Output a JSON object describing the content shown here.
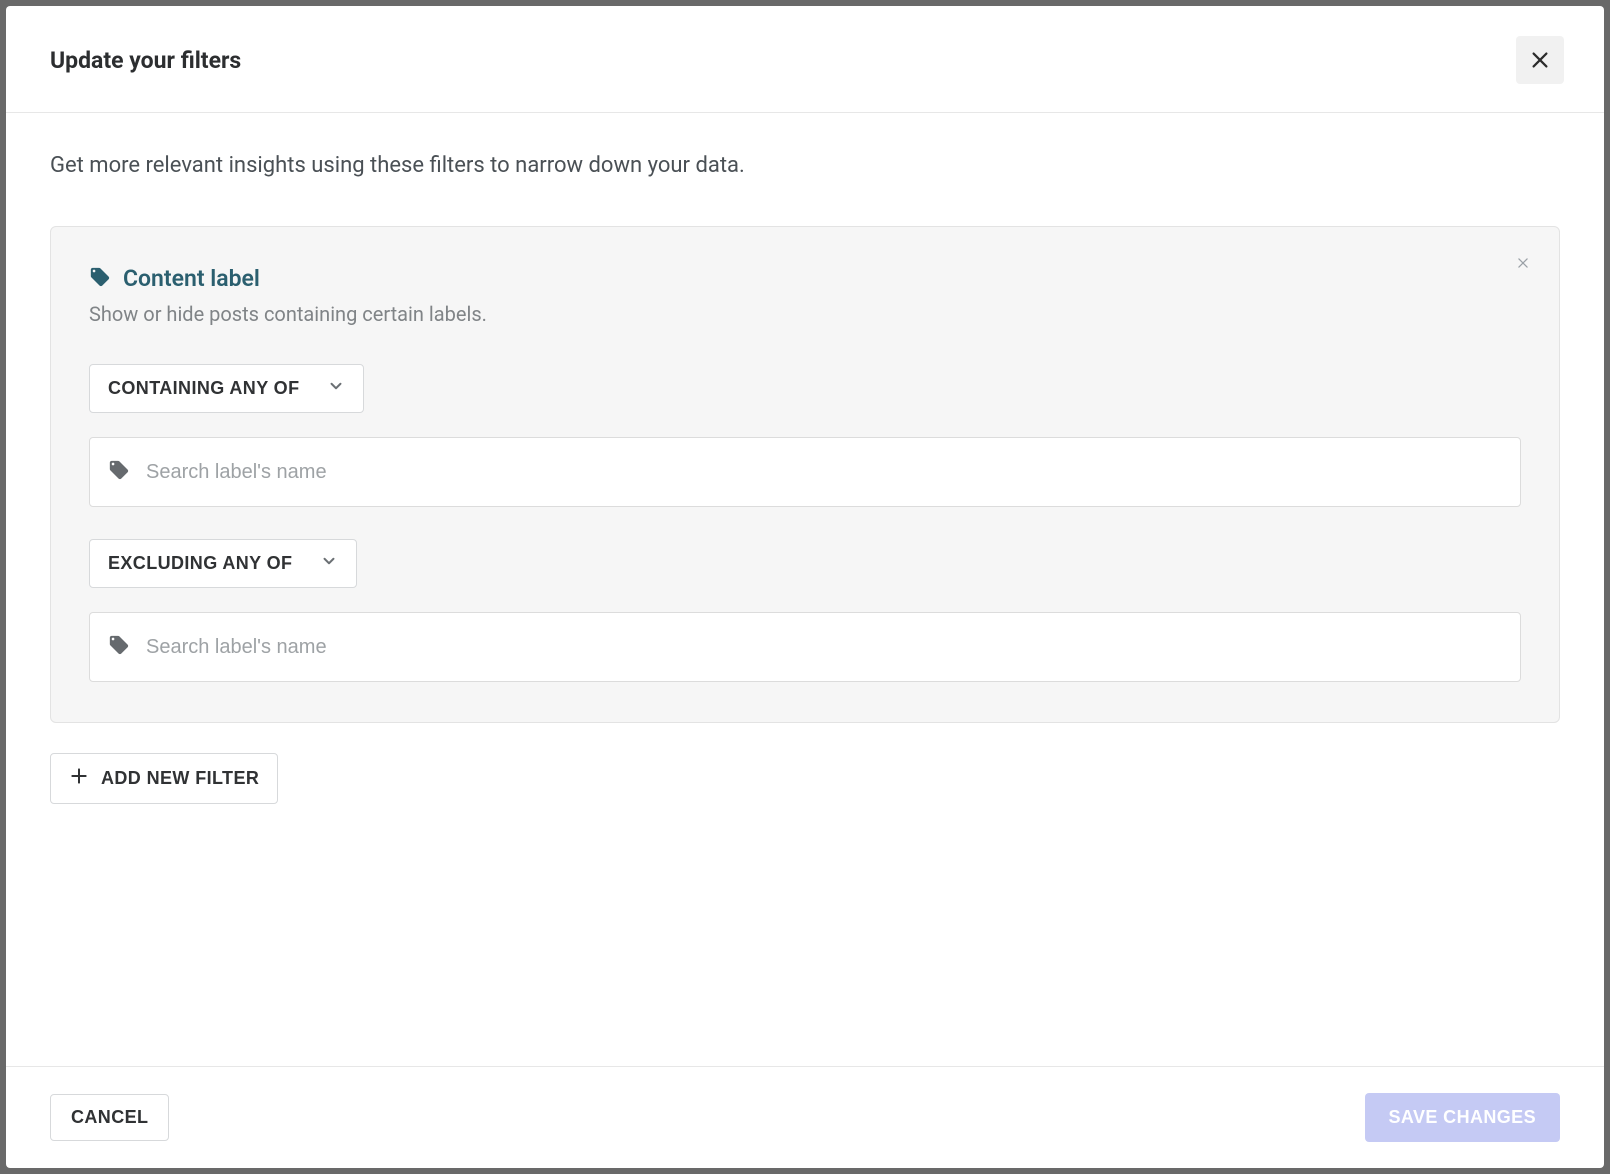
{
  "modal": {
    "title": "Update your filters",
    "description": "Get more relevant insights using these filters to narrow down your data."
  },
  "filter_card": {
    "title": "Content label",
    "subtitle": "Show or hide posts containing certain labels.",
    "include": {
      "select_label": "CONTAINING ANY OF",
      "search_placeholder": "Search label's name"
    },
    "exclude": {
      "select_label": "EXCLUDING ANY OF",
      "search_placeholder": "Search label's name"
    }
  },
  "actions": {
    "add_new_filter": "ADD NEW FILTER",
    "cancel": "CANCEL",
    "save_changes": "SAVE CHANGES"
  },
  "colors": {
    "accent_teal": "#2b5f6f",
    "save_button_bg": "#c5caf4"
  }
}
